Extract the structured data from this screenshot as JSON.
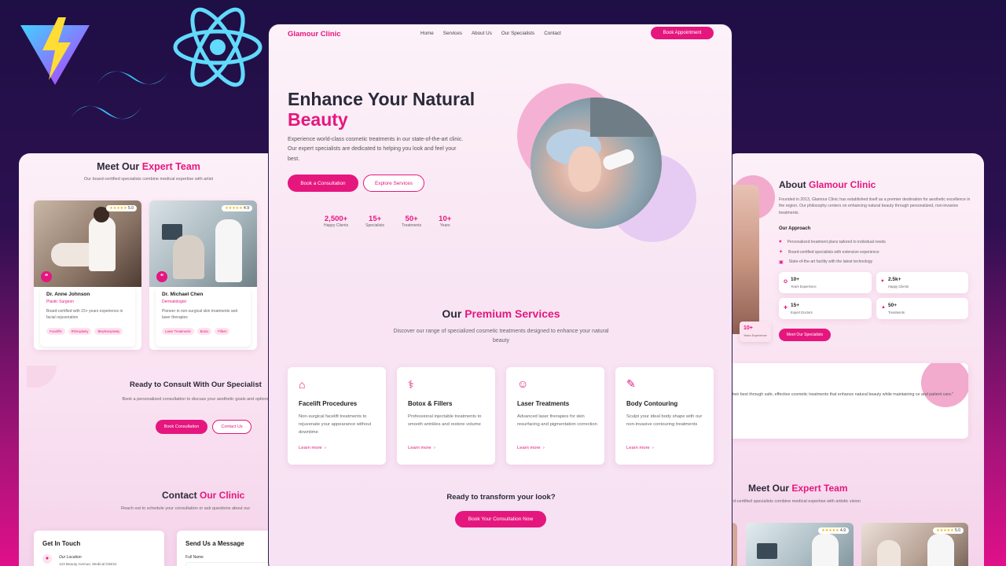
{
  "left": {
    "team_title_a": "Meet Our",
    "team_title_b": "Expert Team",
    "team_sub": "Our board-certified specialists combine medical expertise with artist",
    "doctors": [
      {
        "rating": "5.0",
        "name": "Dr. Anne Johnson",
        "role": "Plastic Surgeon",
        "bio": "Board-certified with 15+ years experience in facial rejuvenation",
        "tags": [
          "Facelifts",
          "Rhinoplasty",
          "Blepharoplasty"
        ]
      },
      {
        "rating": "4.9",
        "name": "Dr. Michael Chen",
        "role": "Dermatologist",
        "bio": "Pioneer in non-surgical skin treatments and laser therapies",
        "tags": [
          "Laser Treatments",
          "Botox",
          "Fillers"
        ]
      }
    ],
    "consult_title": "Ready to Consult With Our Specialist",
    "consult_sub": "Book a personalized consultation to discuss your aesthetic goals and options",
    "book_btn": "Book Consultation",
    "contact_btn": "Contact Us",
    "contact_title_a": "Contact",
    "contact_title_b": "Our Clinic",
    "contact_sub": "Reach out to schedule your consultation or ask questions about our",
    "get_in_touch": "Get In Touch",
    "location_label": "Our Location",
    "location_value": "123 Beauty Avenue, Medical District",
    "send_msg": "Send Us a Message",
    "full_name": "Full Name"
  },
  "center": {
    "brand": "Glamour Clinic",
    "nav": [
      "Home",
      "Services",
      "About Us",
      "Our Specialists",
      "Contact"
    ],
    "book_appt": "Book Appointment",
    "hero_a": "Enhance Your Natural",
    "hero_b": "Beauty",
    "hero_desc": "Experience world-class cosmetic treatments in our state-of-the-art clinic. Our expert specialists are dedicated to helping you look and feel your best.",
    "cta_primary": "Book a Consultation",
    "cta_secondary": "Explore Services",
    "stats": [
      {
        "value": "2,500+",
        "label": "Happy Clients"
      },
      {
        "value": "15+",
        "label": "Specialists"
      },
      {
        "value": "50+",
        "label": "Treatments"
      },
      {
        "value": "10+",
        "label": "Years"
      }
    ],
    "services_title_a": "Our",
    "services_title_b": "Premium Services",
    "services_sub": "Discover our range of specialized cosmetic treatments designed to enhance your natural beauty",
    "services": [
      {
        "icon": "home-icon",
        "title": "Facelift Procedures",
        "desc": "Non-surgical facelift treatments to rejuvenate your appearance without downtime",
        "link": "Learn more"
      },
      {
        "icon": "doctor-icon",
        "title": "Botox & Fillers",
        "desc": "Professional injectable treatments to smooth wrinkles and restore volume",
        "link": "Learn more"
      },
      {
        "icon": "smile-icon",
        "title": "Laser Treatments",
        "desc": "Advanced laser therapies for skin resurfacing and pigmentation correction",
        "link": "Learn more"
      },
      {
        "icon": "syringe-icon",
        "title": "Body Contouring",
        "desc": "Sculpt your ideal body shape with our non-invasive contouring treatments",
        "link": "Learn more"
      }
    ],
    "transform_title": "Ready to transform your look?",
    "transform_btn": "Book Your Consultation Now"
  },
  "right": {
    "about_a": "About",
    "about_b": "Glamour Clinic",
    "about_desc": "Founded in 2013, Glamour Clinic has established itself as a premier destination for aesthetic excellence in the region. Our philosophy centers on enhancing natural beauty through personalized, non-invasive treatments.",
    "approach_title": "Our Approach",
    "approach": [
      "Personalized treatment plans tailored to individual needs",
      "Board-certified specialists with extensive experience",
      "State-of-the-art facility with the latest technology"
    ],
    "stats": [
      {
        "value": "10+",
        "label": "Years Experience"
      },
      {
        "value": "2.5k+",
        "label": "Happy Clients"
      },
      {
        "value": "15+",
        "label": "Expert Doctors"
      },
      {
        "value": "50+",
        "label": "Treatments"
      }
    ],
    "badge_value": "10+",
    "badge_label": "Years Experience",
    "meet_btn": "Meet Our Specialists",
    "quote": "their best through safe, effective cosmetic treatments that enhance natural beauty while maintaining ce and patient care.\"",
    "team_title_a": "Meet Our",
    "team_title_b": "Expert Team",
    "team_sub": "ard-certified specialists combine medical expertise with artistic vision",
    "ratings": [
      "4.9",
      "5.0"
    ]
  },
  "colors": {
    "accent": "#e5177e",
    "bg_top": "#1e0f45",
    "bg_bottom": "#e0108a",
    "react": "#61dafb",
    "tailwind": "#38bdf8"
  }
}
